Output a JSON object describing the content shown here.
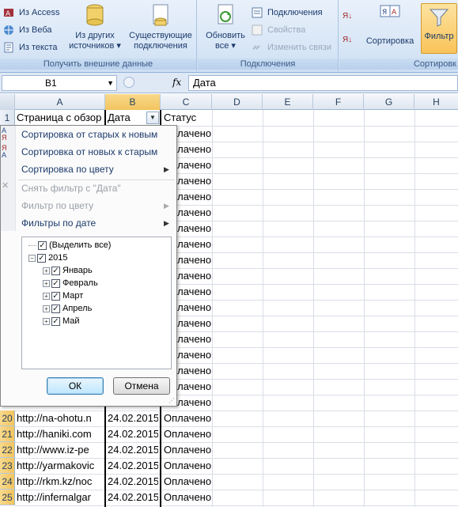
{
  "ribbon": {
    "group_external": {
      "label": "Получить внешние данные",
      "from_access": "Из Access",
      "from_web": "Из Веба",
      "from_text": "Из текста",
      "from_other_1": "Из других",
      "from_other_2": "источников ▾",
      "existing_1": "Существующие",
      "existing_2": "подключения"
    },
    "group_connections": {
      "label": "Подключения",
      "refresh_1": "Обновить",
      "refresh_2": "все ▾",
      "connections": "Подключения",
      "properties": "Свойства",
      "edit_links": "Изменить связи"
    },
    "group_sort": {
      "label": "Сортировк",
      "sort": "Сортировка",
      "filter": "Фильтр"
    }
  },
  "formula_bar": {
    "name_box": "B1",
    "fx": "fx",
    "formula": "Дата"
  },
  "columns": [
    "A",
    "B",
    "C",
    "D",
    "E",
    "F",
    "G",
    "H"
  ],
  "header_row": {
    "num": "1",
    "a": "Страница с обзор",
    "b": "Дата",
    "c": "Статус"
  },
  "status_value": "Оплачено",
  "rows": [
    {
      "num": "20",
      "a": "http://na-ohotu.n",
      "b": "24.02.2015",
      "c": "Оплачено"
    },
    {
      "num": "21",
      "a": "http://haniki.com",
      "b": "24.02.2015",
      "c": "Оплачено"
    },
    {
      "num": "22",
      "a": "http://www.iz-pe",
      "b": "24.02.2015",
      "c": "Оплачено"
    },
    {
      "num": "23",
      "a": "http://yarmakovic",
      "b": "24.02.2015",
      "c": "Оплачено"
    },
    {
      "num": "24",
      "a": "http://rkm.kz/noc",
      "b": "24.02.2015",
      "c": "Оплачено"
    },
    {
      "num": "25",
      "a": "http://infernalgar",
      "b": "24.02.2015",
      "c": "Оплачено"
    }
  ],
  "filter_menu": {
    "sort_old_new": "Сортировка от старых к новым",
    "sort_new_old": "Сортировка от новых к старым",
    "sort_by_color": "Сортировка по цвету",
    "clear_filter": "Снять фильтр с \"Дата\"",
    "filter_by_color": "Фильтр по цвету",
    "date_filters": "Фильтры по дате",
    "tree": {
      "select_all": "(Выделить все)",
      "year": "2015",
      "months": [
        "Январь",
        "Февраль",
        "Март",
        "Апрель",
        "Май"
      ]
    },
    "ok": "ОК",
    "cancel": "Отмена"
  }
}
